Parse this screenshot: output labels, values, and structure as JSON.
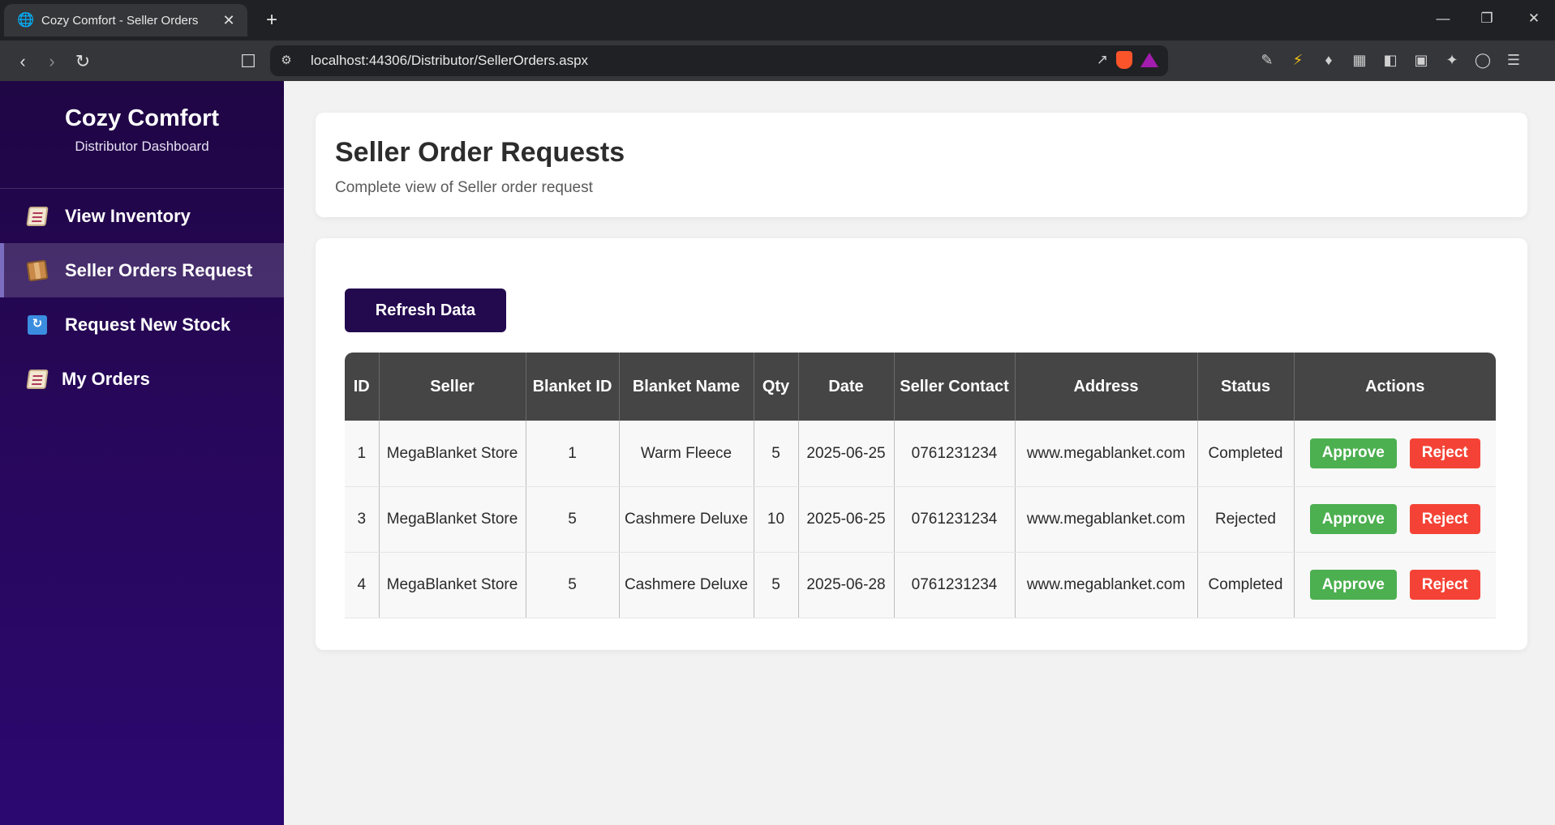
{
  "browser": {
    "tab_title": "Cozy Comfort - Seller Orders",
    "url": "localhost:44306/Distributor/SellerOrders.aspx"
  },
  "sidebar": {
    "brand_title": "Cozy Comfort",
    "brand_subtitle": "Distributor Dashboard",
    "items": [
      {
        "label": "View Inventory",
        "icon": "memo-icon",
        "active": false
      },
      {
        "label": "Seller Orders Request",
        "icon": "package-icon",
        "active": true
      },
      {
        "label": "Request New Stock",
        "icon": "refresh-icon",
        "active": false
      },
      {
        "label": "My Orders",
        "icon": "memo-icon",
        "active": false
      }
    ]
  },
  "header": {
    "title": "Seller Order Requests",
    "subtitle": "Complete view of Seller order request"
  },
  "actions": {
    "refresh_label": "Refresh Data"
  },
  "table": {
    "columns": [
      "ID",
      "Seller",
      "Blanket ID",
      "Blanket Name",
      "Qty",
      "Date",
      "Seller Contact",
      "Address",
      "Status",
      "Actions"
    ],
    "approve_label": "Approve",
    "reject_label": "Reject",
    "rows": [
      {
        "id": "1",
        "seller": "MegaBlanket Store",
        "blanket_id": "1",
        "blanket_name": "Warm Fleece",
        "qty": "5",
        "date": "2025-06-25",
        "contact": "0761231234",
        "address": "www.megablanket.com",
        "status": "Completed"
      },
      {
        "id": "3",
        "seller": "MegaBlanket Store",
        "blanket_id": "5",
        "blanket_name": "Cashmere Deluxe",
        "qty": "10",
        "date": "2025-06-25",
        "contact": "0761231234",
        "address": "www.megablanket.com",
        "status": "Rejected"
      },
      {
        "id": "4",
        "seller": "MegaBlanket Store",
        "blanket_id": "5",
        "blanket_name": "Cashmere Deluxe",
        "qty": "5",
        "date": "2025-06-28",
        "contact": "0761231234",
        "address": "www.megablanket.com",
        "status": "Completed"
      }
    ]
  },
  "colors": {
    "sidebar_bg": "#23094e",
    "approve": "#4caf50",
    "reject": "#f44336",
    "table_header": "#454545"
  }
}
